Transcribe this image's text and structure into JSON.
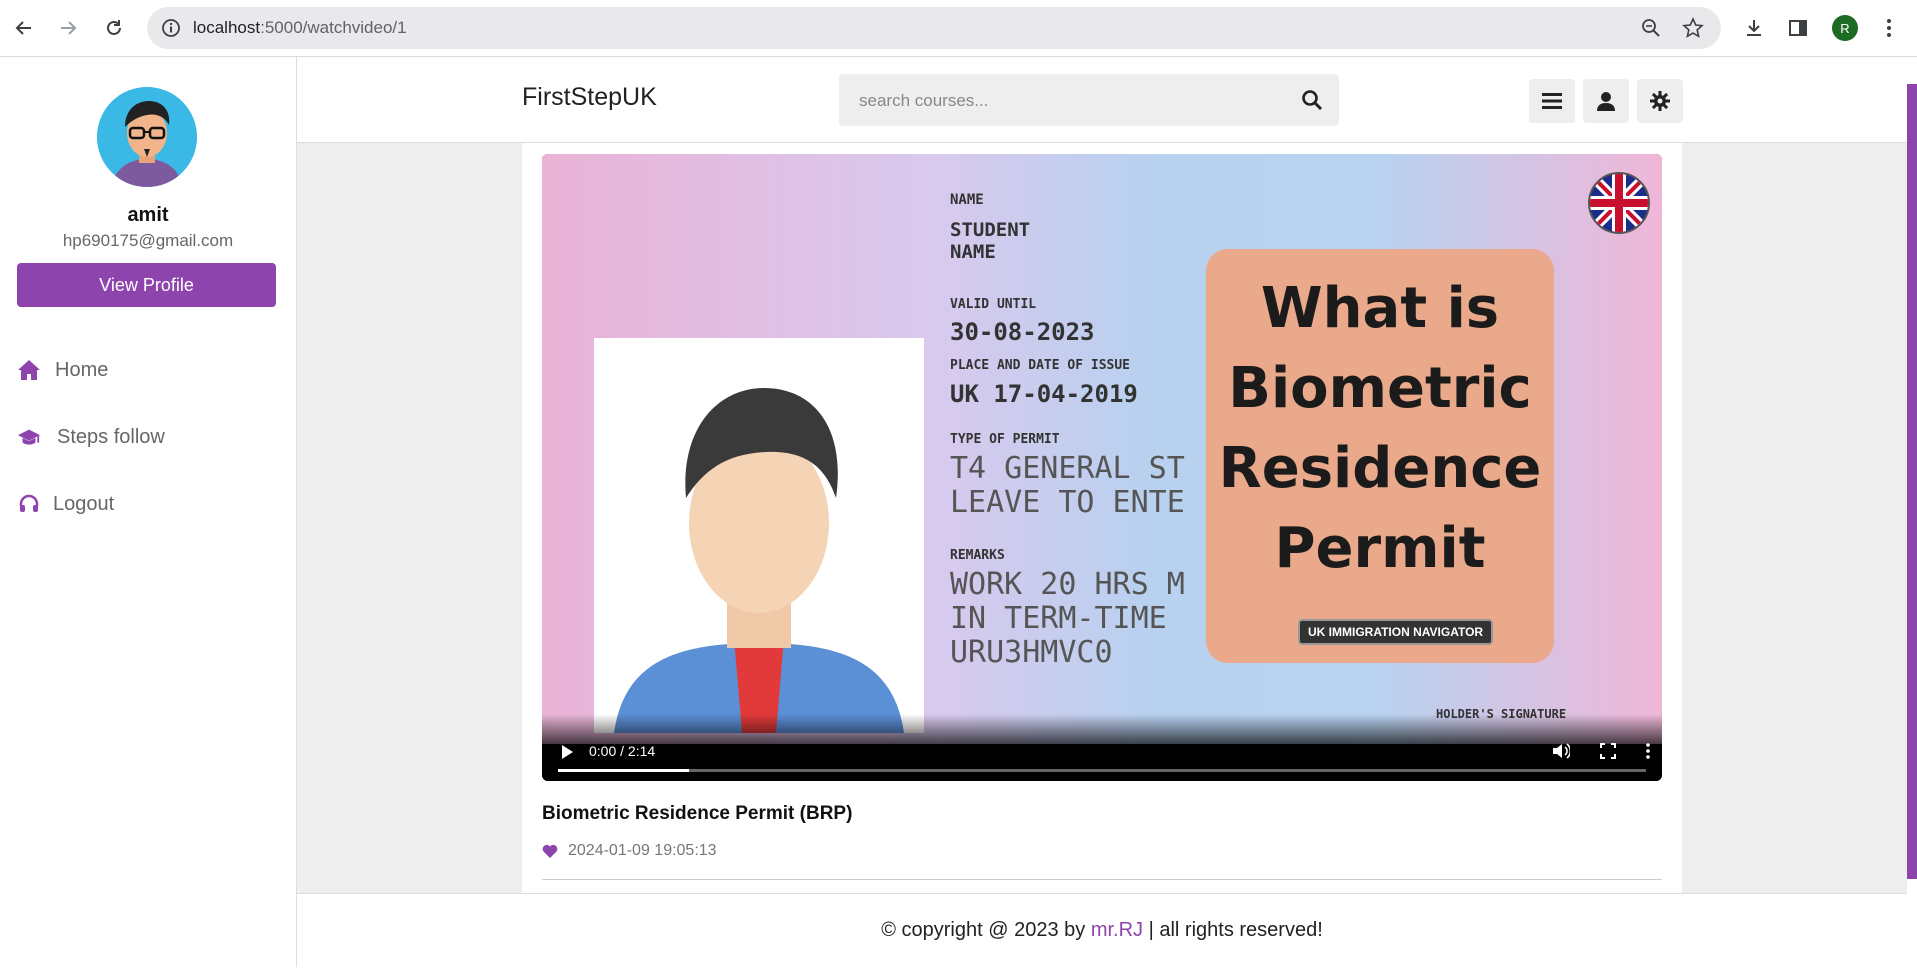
{
  "browser": {
    "url_host": "localhost",
    "url_path": ":5000/watchvideo/1",
    "profile_initial": "R"
  },
  "sidebar": {
    "user_name": "amit",
    "user_email": "hp690175@gmail.com",
    "view_profile_label": "View Profile",
    "items": [
      {
        "label": "Home",
        "icon": "home-icon"
      },
      {
        "label": "Steps follow",
        "icon": "graduation-cap-icon"
      },
      {
        "label": "Logout",
        "icon": "headset-icon"
      }
    ]
  },
  "header": {
    "logo": "FirstStepUK",
    "search_placeholder": "search courses..."
  },
  "video": {
    "time": "0:00 / 2:14",
    "progress_fraction": 0.12,
    "title": "Biometric Residence Permit (BRP)",
    "date": "2024-01-09 19:05:13",
    "thumbnail": {
      "line1": "What is",
      "line2": "Biometric",
      "line3": "Residence",
      "line4": "Permit",
      "tag": "UK IMMIGRATION NAVIGATOR",
      "name_label": "NAME",
      "name_value": "STUDENT NAME",
      "valid_label": "VALID UNTIL",
      "valid_value": "30-08-2023",
      "place_label": "PLACE AND DATE OF ISSUE",
      "place_value": "UK 17-04-2019",
      "type_label": "TYPE OF PERMIT",
      "type_value": "T4 GENERAL ST LEAVE TO ENTE",
      "remarks_label": "REMARKS",
      "remarks_value": "WORK 20 HRS M IN TERM-TIME URU3HMVC0",
      "signature_label": "HOLDER'S SIGNATURE"
    }
  },
  "footer": {
    "prefix": "© copyright @ 2023 by",
    "brand": "mr.RJ",
    "suffix": "| all rights reserved!"
  },
  "colors": {
    "accent": "#8e44ad"
  }
}
